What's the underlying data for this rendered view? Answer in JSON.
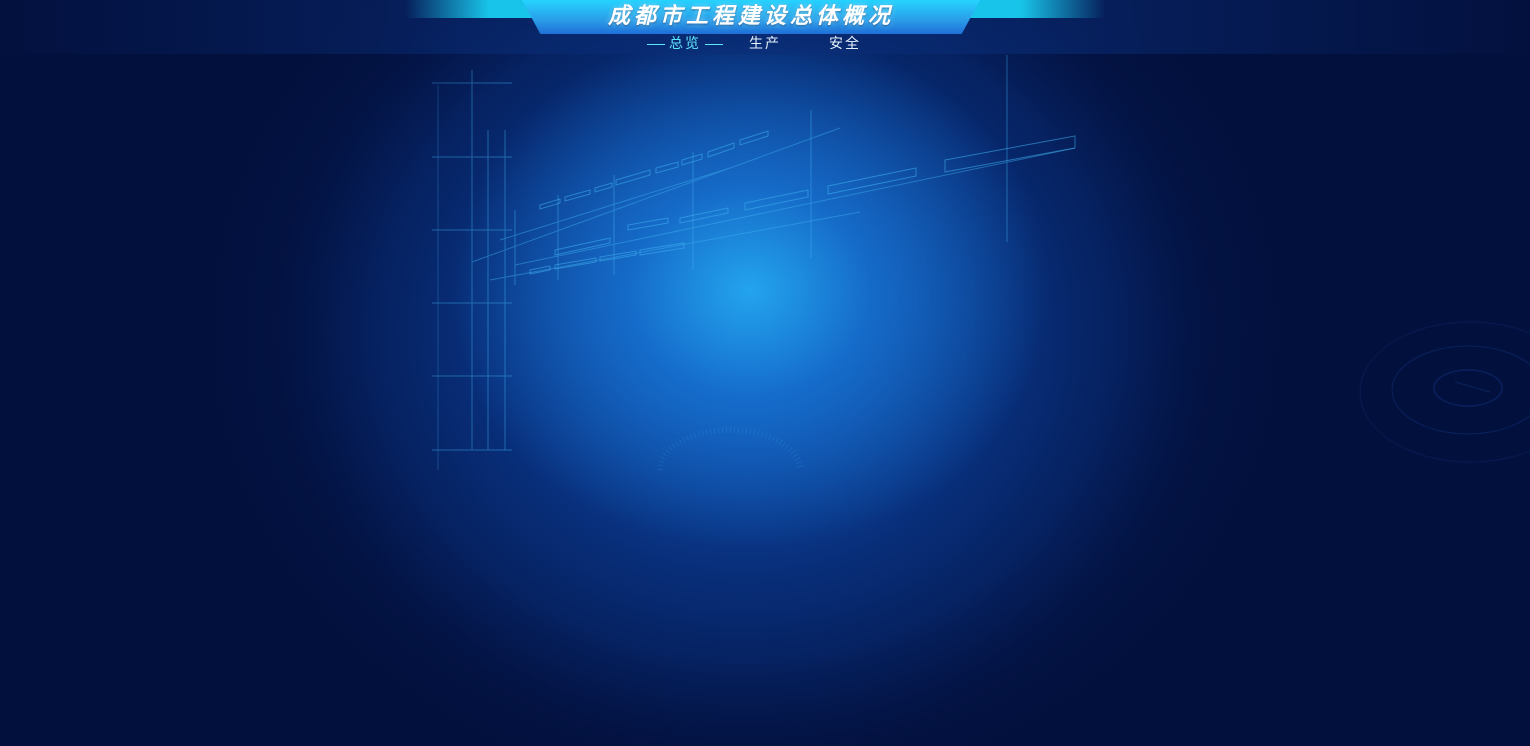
{
  "header": {
    "title": "成都市工程建设总体概况",
    "tabs": [
      {
        "label": "总览",
        "active": true
      },
      {
        "label": "生产",
        "active": false
      },
      {
        "label": "安全",
        "active": false
      }
    ]
  },
  "colors": {
    "background": "#031446",
    "glow_center": "#24a8f0",
    "accent": "#25d3ff",
    "active_tab": "#5ee8ff"
  }
}
